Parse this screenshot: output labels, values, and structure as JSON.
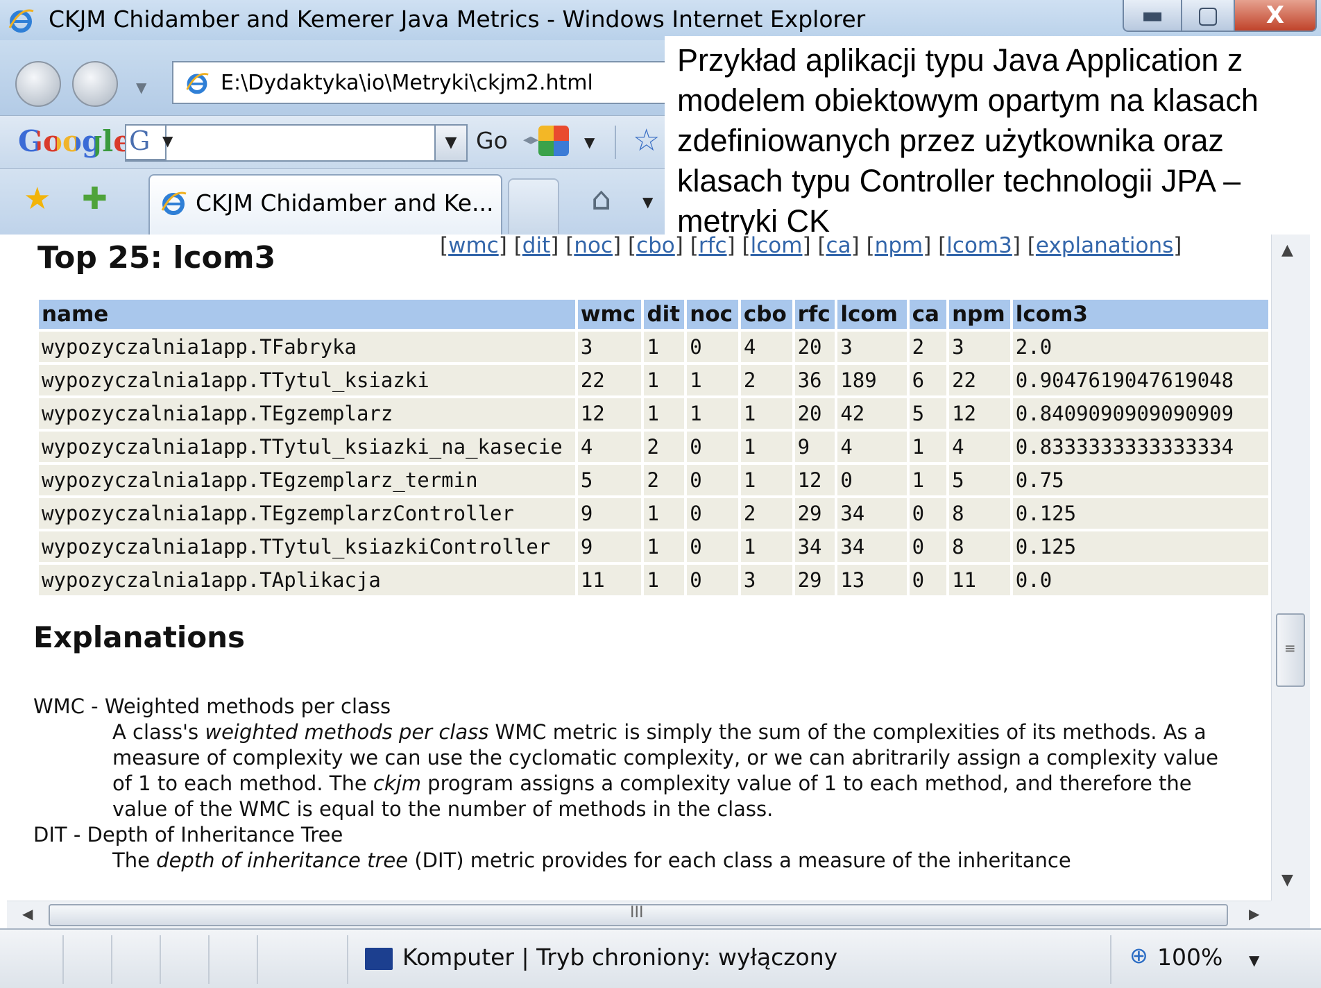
{
  "window": {
    "title": "CKJM Chidamber and Kemerer Java Metrics - Windows Internet Explorer",
    "address": "E:\\Dydaktyka\\io\\Metryki\\ckjm2.html",
    "tab_label": "CKJM Chidamber and Ke...",
    "minimize_glyph": "▬",
    "maximize_glyph": "▢",
    "close_glyph": "X"
  },
  "googlebar": {
    "logo": "Google",
    "g_button": "G",
    "go_label": "Go",
    "search_value": ""
  },
  "caption": {
    "text": "Przykład aplikacji typu Java Application z modelem obiektowym opartym na klasach zdefiniowanych przez użytkownika oraz klasach typu Controller technologii JPA – metryki CK"
  },
  "page": {
    "title": "Top 25: lcom3",
    "links": [
      "wmc",
      "dit",
      "noc",
      "cbo",
      "rfc",
      "lcom",
      "ca",
      "npm",
      "lcom3",
      "explanations"
    ]
  },
  "table": {
    "headers": [
      "name",
      "wmc",
      "dit",
      "noc",
      "cbo",
      "rfc",
      "lcom",
      "ca",
      "npm",
      "lcom3"
    ],
    "rows": [
      [
        "wypozyczalnia1app.TFabryka",
        "3",
        "1",
        "0",
        "4",
        "20",
        "3",
        "2",
        "3",
        "2.0"
      ],
      [
        "wypozyczalnia1app.TTytul_ksiazki",
        "22",
        "1",
        "1",
        "2",
        "36",
        "189",
        "6",
        "22",
        "0.9047619047619048"
      ],
      [
        "wypozyczalnia1app.TEgzemplarz",
        "12",
        "1",
        "1",
        "1",
        "20",
        "42",
        "5",
        "12",
        "0.8409090909090909"
      ],
      [
        "wypozyczalnia1app.TTytul_ksiazki_na_kasecie",
        "4",
        "2",
        "0",
        "1",
        "9",
        "4",
        "1",
        "4",
        "0.8333333333333334"
      ],
      [
        "wypozyczalnia1app.TEgzemplarz_termin",
        "5",
        "2",
        "0",
        "1",
        "12",
        "0",
        "1",
        "5",
        "0.75"
      ],
      [
        "wypozyczalnia1app.TEgzemplarzController",
        "9",
        "1",
        "0",
        "2",
        "29",
        "34",
        "0",
        "8",
        "0.125"
      ],
      [
        "wypozyczalnia1app.TTytul_ksiazkiController",
        "9",
        "1",
        "0",
        "1",
        "34",
        "34",
        "0",
        "8",
        "0.125"
      ],
      [
        "wypozyczalnia1app.TAplikacja",
        "11",
        "1",
        "0",
        "3",
        "29",
        "13",
        "0",
        "11",
        "0.0"
      ]
    ]
  },
  "explanations": {
    "title": "Explanations",
    "wmc_term": "WMC - Weighted methods per class",
    "wmc_p1": "A class's ",
    "wmc_em1": "weighted methods per class",
    "wmc_p2": " WMC metric is simply the sum of the complexities of its methods. As a measure of complexity we can use the cyclomatic complexity, or we can abritrarily assign a complexity value of 1 to each method. The ",
    "wmc_em2": "ckjm",
    "wmc_p3": " program assigns a complexity value of 1 to each method, and therefore the value of the WMC is equal to the number of methods in the class.",
    "dit_term": "DIT - Depth of Inheritance Tree",
    "dit_p1": "The ",
    "dit_em1": "depth of inheritance tree",
    "dit_p2": " (DIT) metric provides for each class a measure of the inheritance"
  },
  "scrollbars": {
    "vertical_position": 0.65,
    "horizontal_grip": "III",
    "vertical_grip": "≡"
  },
  "statusbar": {
    "zone": "Komputer | Tryb chroniony: wyłączony",
    "zoom": "100%"
  }
}
